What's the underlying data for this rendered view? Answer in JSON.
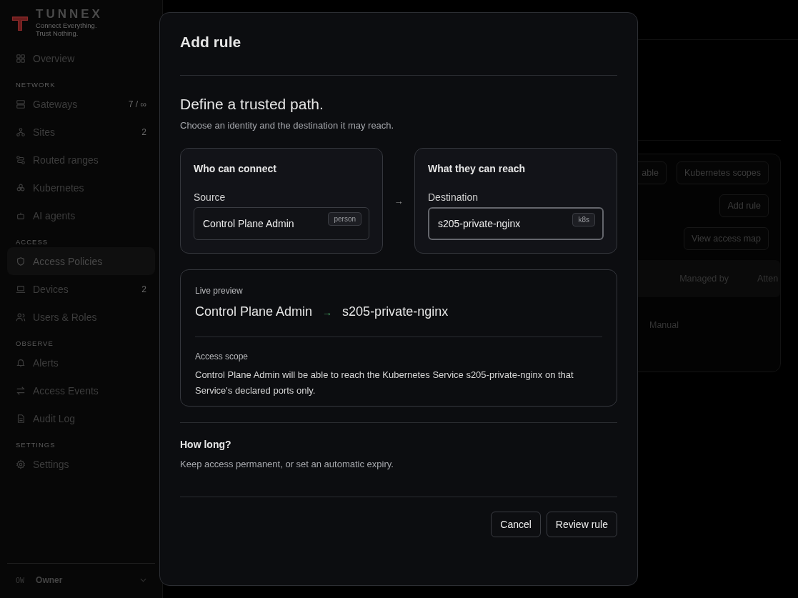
{
  "brand": {
    "name": "TUNNEX",
    "tagline": [
      "Connect Everything.",
      "Trust Nothing."
    ]
  },
  "sidebar": {
    "sections": [
      {
        "items": [
          {
            "label": "Overview",
            "selected": false
          }
        ]
      },
      {
        "heading": "NETWORK",
        "items": [
          {
            "label": "Gateways",
            "count": "7 / ∞",
            "selected": false
          },
          {
            "label": "Sites",
            "count": "2",
            "selected": false
          },
          {
            "label": "Routed ranges",
            "selected": false
          },
          {
            "label": "Kubernetes",
            "selected": false
          },
          {
            "label": "AI agents",
            "selected": false
          }
        ]
      },
      {
        "heading": "ACCESS",
        "items": [
          {
            "label": "Access Policies",
            "selected": true
          },
          {
            "label": "Devices",
            "count": "2",
            "selected": false
          },
          {
            "label": "Users & Roles",
            "selected": false
          }
        ]
      },
      {
        "heading": "OBSERVE",
        "items": [
          {
            "label": "Alerts",
            "selected": false
          },
          {
            "label": "Access Events",
            "selected": false
          },
          {
            "label": "Audit Log",
            "selected": false
          }
        ]
      },
      {
        "heading": "SETTINGS",
        "items": [
          {
            "label": "Settings",
            "selected": false
          }
        ]
      }
    ],
    "user": {
      "initials": "OW",
      "name": "Owner"
    }
  },
  "background": {
    "tabs": [
      "able",
      "Kubernetes scopes"
    ],
    "add_button": "Add rule",
    "map_button": "View access map",
    "columns": [
      "Managed by",
      "Atten"
    ],
    "cell": "Manual"
  },
  "modal": {
    "title": "Add rule",
    "heading": "Define a trusted path.",
    "subtitle": "Choose an identity and the destination it may reach.",
    "source": {
      "title": "Who can connect",
      "label": "Source",
      "value": "Control Plane Admin",
      "badge": "person",
      "focused": false
    },
    "arrow": "→",
    "destination": {
      "title": "What they can reach",
      "label": "Destination",
      "value": "s205-private-nginx",
      "badge": "k8s",
      "focused": true
    },
    "preview": {
      "label": "Live preview",
      "from": "Control Plane Admin",
      "arrow": "→",
      "to": "s205-private-nginx",
      "scope_label": "Access scope",
      "scope_text": "Control Plane Admin will be able to reach the Kubernetes Service s205-private-nginx on that Service's declared ports only."
    },
    "duration": {
      "title": "How long?",
      "text": "Keep access permanent, or set an automatic expiry."
    },
    "buttons": {
      "cancel": "Cancel",
      "confirm": "Review rule"
    }
  }
}
